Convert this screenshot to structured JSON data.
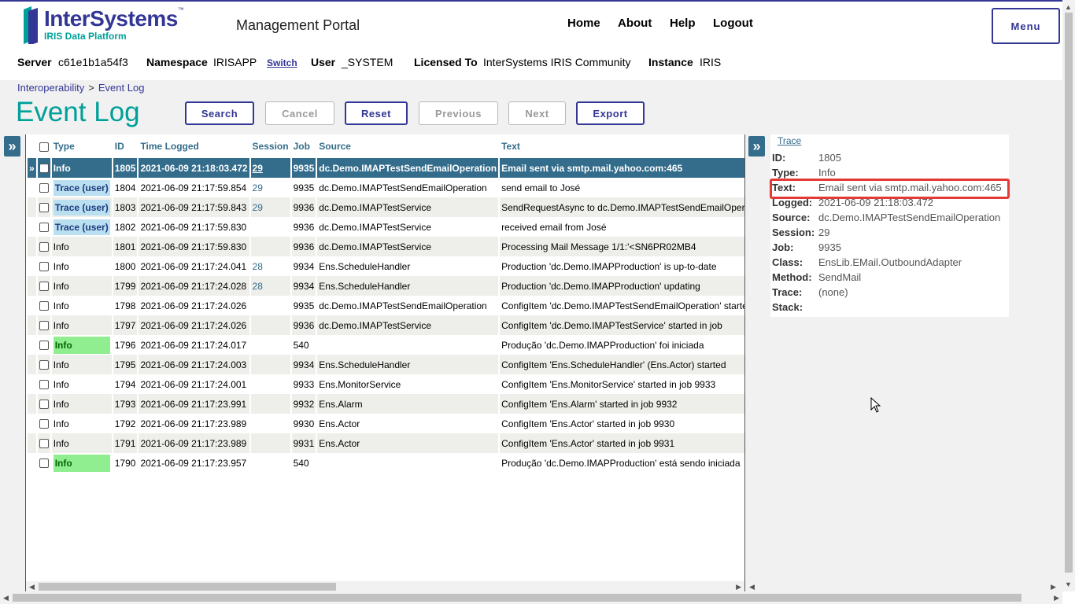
{
  "brand": {
    "name": "InterSystems",
    "tm": "™",
    "subtitle": "IRIS Data Platform"
  },
  "portal_title": "Management Portal",
  "topnav": [
    "Home",
    "About",
    "Help",
    "Logout"
  ],
  "menu_label": "Menu",
  "infobar": {
    "server_label": "Server",
    "server": "c61e1b1a54f3",
    "namespace_label": "Namespace",
    "namespace": "IRISAPP",
    "switch": "Switch",
    "user_label": "User",
    "user": "_SYSTEM",
    "licensed_label": "Licensed To",
    "licensed": "InterSystems IRIS Community",
    "instance_label": "Instance",
    "instance": "IRIS"
  },
  "breadcrumb": {
    "parent": "Interoperability",
    "sep": ">",
    "current": "Event Log"
  },
  "page_title": "Event Log",
  "buttons": {
    "search": "Search",
    "cancel": "Cancel",
    "reset": "Reset",
    "previous": "Previous",
    "next": "Next",
    "export": "Export"
  },
  "expander_glyph": "»",
  "table": {
    "headers": {
      "type": "Type",
      "id": "ID",
      "time": "Time Logged",
      "session": "Session",
      "job": "Job",
      "source": "Source",
      "text": "Text"
    },
    "rows": [
      {
        "marker": "»",
        "type": "Info",
        "id": "1805",
        "time": "2021-06-09 21:18:03.472",
        "session": "29",
        "job": "9935",
        "source": "dc.Demo.IMAPTestSendEmailOperation",
        "text": "Email sent via smtp.mail.yahoo.com:465"
      },
      {
        "marker": "",
        "type": "Trace (user)",
        "id": "1804",
        "time": "2021-06-09 21:17:59.854",
        "session": "29",
        "job": "9935",
        "source": "dc.Demo.IMAPTestSendEmailOperation",
        "text": "send email to José"
      },
      {
        "marker": "",
        "type": "Trace (user)",
        "id": "1803",
        "time": "2021-06-09 21:17:59.843",
        "session": "29",
        "job": "9936",
        "source": "dc.Demo.IMAPTestService",
        "text": "SendRequestAsync to dc.Demo.IMAPTestSendEmailOperation"
      },
      {
        "marker": "",
        "type": "Trace (user)",
        "id": "1802",
        "time": "2021-06-09 21:17:59.830",
        "session": "",
        "job": "9936",
        "source": "dc.Demo.IMAPTestService",
        "text": "received email from José"
      },
      {
        "marker": "",
        "type": "Info",
        "id": "1801",
        "time": "2021-06-09 21:17:59.830",
        "session": "",
        "job": "9936",
        "source": "dc.Demo.IMAPTestService",
        "text": "Processing Mail Message 1/1:'<SN6PR02MB4"
      },
      {
        "marker": "",
        "type": "Info",
        "id": "1800",
        "time": "2021-06-09 21:17:24.041",
        "session": "28",
        "job": "9934",
        "source": "Ens.ScheduleHandler",
        "text": "Production 'dc.Demo.IMAPProduction' is up-to-date"
      },
      {
        "marker": "",
        "type": "Info",
        "id": "1799",
        "time": "2021-06-09 21:17:24.028",
        "session": "28",
        "job": "9934",
        "source": "Ens.ScheduleHandler",
        "text": "Production 'dc.Demo.IMAPProduction' updating"
      },
      {
        "marker": "",
        "type": "Info",
        "id": "1798",
        "time": "2021-06-09 21:17:24.026",
        "session": "",
        "job": "9935",
        "source": "dc.Demo.IMAPTestSendEmailOperation",
        "text": "ConfigItem 'dc.Demo.IMAPTestSendEmailOperation' started"
      },
      {
        "marker": "",
        "type": "Info",
        "id": "1797",
        "time": "2021-06-09 21:17:24.026",
        "session": "",
        "job": "9936",
        "source": "dc.Demo.IMAPTestService",
        "text": "ConfigItem 'dc.Demo.IMAPTestService' started in job"
      },
      {
        "marker": "",
        "type": "Info",
        "id": "1796",
        "time": "2021-06-09 21:17:24.017",
        "session": "",
        "job": "540",
        "source": "",
        "text": "Produção 'dc.Demo.IMAPProduction' foi iniciada"
      },
      {
        "marker": "",
        "type": "Info",
        "id": "1795",
        "time": "2021-06-09 21:17:24.003",
        "session": "",
        "job": "9934",
        "source": "Ens.ScheduleHandler",
        "text": "ConfigItem 'Ens.ScheduleHandler' (Ens.Actor) started"
      },
      {
        "marker": "",
        "type": "Info",
        "id": "1794",
        "time": "2021-06-09 21:17:24.001",
        "session": "",
        "job": "9933",
        "source": "Ens.MonitorService",
        "text": "ConfigItem 'Ens.MonitorService' started in job 9933"
      },
      {
        "marker": "",
        "type": "Info",
        "id": "1793",
        "time": "2021-06-09 21:17:23.991",
        "session": "",
        "job": "9932",
        "source": "Ens.Alarm",
        "text": "ConfigItem 'Ens.Alarm' started in job 9932"
      },
      {
        "marker": "",
        "type": "Info",
        "id": "1792",
        "time": "2021-06-09 21:17:23.989",
        "session": "",
        "job": "9930",
        "source": "Ens.Actor",
        "text": "ConfigItem 'Ens.Actor' started in job 9930"
      },
      {
        "marker": "",
        "type": "Info",
        "id": "1791",
        "time": "2021-06-09 21:17:23.989",
        "session": "",
        "job": "9931",
        "source": "Ens.Actor",
        "text": "ConfigItem 'Ens.Actor' started in job 9931"
      },
      {
        "marker": "",
        "type": "Info",
        "id": "1790",
        "time": "2021-06-09 21:17:23.957",
        "session": "",
        "job": "540",
        "source": "",
        "text": "Produção 'dc.Demo.IMAPProduction' está sendo iniciada"
      }
    ]
  },
  "detail": {
    "tab": "Trace",
    "fields": [
      {
        "k": "ID:",
        "v": "1805"
      },
      {
        "k": "Type:",
        "v": "Info"
      },
      {
        "k": "Text:",
        "v": "Email sent via smtp.mail.yahoo.com:465"
      },
      {
        "k": "Logged:",
        "v": "2021-06-09 21:18:03.472"
      },
      {
        "k": "Source:",
        "v": "dc.Demo.IMAPTestSendEmailOperation"
      },
      {
        "k": "Session:",
        "v": "29"
      },
      {
        "k": "Job:",
        "v": "9935"
      },
      {
        "k": "Class:",
        "v": "EnsLib.EMail.OutboundAdapter"
      },
      {
        "k": "Method:",
        "v": "SendMail"
      },
      {
        "k": "Trace:",
        "v": "(none)"
      },
      {
        "k": "Stack:",
        "v": ""
      }
    ]
  },
  "colors": {
    "brand": "#333695",
    "teal": "#00a09a",
    "header_blue": "#346c8b",
    "trace_bg": "#b9dff0",
    "info_green": "#90ee90",
    "highlight": "#e53935"
  }
}
